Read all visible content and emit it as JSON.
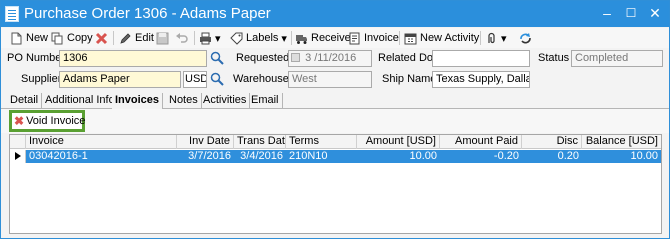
{
  "window": {
    "title": "Purchase Order 1306 - Adams Paper"
  },
  "title_buttons": {
    "minimize": "–",
    "maximize": "☐",
    "close": "✕"
  },
  "toolbar": {
    "new_label": "New",
    "copy_label": "Copy",
    "edit_label": "Edit",
    "labels_label": "Labels",
    "receive_label": "Receive",
    "invoice_label": "Invoice",
    "new_activity_label": "New Activity",
    "dropdown_arrow": "▾"
  },
  "form": {
    "po_number_label": "PO Number",
    "po_number_value": "1306",
    "supplier_label": "Supplier",
    "supplier_value": "Adams Paper",
    "currency_value": "USD",
    "requested_label": "Requested",
    "requested_value": "3 /11/2016",
    "warehouse_label": "Warehouse",
    "warehouse_value": "West",
    "related_doc_label": "Related Doc",
    "related_doc_value": "",
    "ship_name_label": "Ship Name",
    "ship_name_value": "Texas Supply, Dallas",
    "status_label": "Status",
    "status_value": "Completed"
  },
  "tabs": [
    {
      "label": "Detail"
    },
    {
      "label": "Additional Info"
    },
    {
      "label": "Invoices"
    },
    {
      "label": "Notes"
    },
    {
      "label": "Activities"
    },
    {
      "label": "Email"
    }
  ],
  "subbar": {
    "void_invoice_label": "Void Invoice"
  },
  "grid": {
    "columns": [
      "Invoice",
      "Inv Date",
      "Trans Date",
      "Terms",
      "Amount [USD]",
      "Amount Paid",
      "Disc",
      "Balance [USD]"
    ],
    "rows": [
      {
        "invoice": "03042016-1",
        "inv_date": "3/7/2016",
        "trans_date": "3/4/2016",
        "terms": "210N10",
        "amount": "10.00",
        "amount_paid": "-0.20",
        "disc": "0.20",
        "balance": "10.00"
      }
    ]
  },
  "colors": {
    "title_bar": "#2b8fdc",
    "selected_row": "#2f8fdc",
    "highlight_border": "#5aa032",
    "required_field": "#fff9d6"
  }
}
